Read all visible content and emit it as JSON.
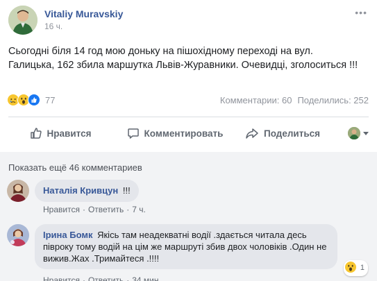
{
  "post": {
    "author": "Vitaliy Muravskiy",
    "time": "16 ч.",
    "text": "Сьогодні біля 14 год мою доньку на пішохідному переході на вул. Галицька, 162 збила маршутка Львів-Журавники. Очевидці, зголоситься !!!",
    "reactions": {
      "icons": [
        "sad",
        "wow",
        "like"
      ],
      "count": "77"
    },
    "comments_count": "Комментарии: 60",
    "shares_count": "Поделились: 252",
    "more_label": "•••"
  },
  "actions": {
    "like": "Нравится",
    "comment": "Комментировать",
    "share": "Поделиться"
  },
  "comments_section": {
    "show_more": "Показать ещё 46 комментариев",
    "comments": [
      {
        "author": "Наталія Кривцун",
        "text": "!!!",
        "like_label": "Нравится",
        "reply_label": "Ответить",
        "time": "7 ч."
      },
      {
        "author": "Ірина Бомк",
        "text": "Якісь там неадекватні водії .здається читала десь півроку тому водій на цім же маршруті збив двох чоловіків .Один не вижив.Жах .Тримайтеся .!!!!",
        "like_label": "Нравится",
        "reply_label": "Ответить",
        "time": "34 мин",
        "reaction": {
          "icon": "wow",
          "count": "1"
        }
      }
    ]
  },
  "colors": {
    "link": "#385898",
    "muted": "#90949c",
    "like_blue": "#1877f2",
    "reaction_yellow": "#f7c62f"
  }
}
